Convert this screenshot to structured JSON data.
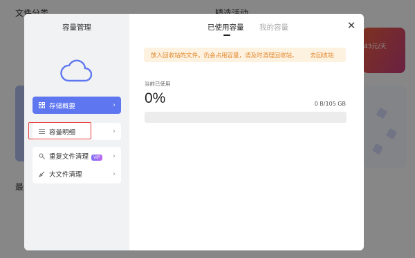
{
  "background": {
    "left_title": "文件分类",
    "mid_title": "精选活动",
    "left_label": "最",
    "banner_text": "43元/天"
  },
  "modal": {
    "sidebar": {
      "title": "容量管理",
      "items": [
        {
          "label": "存储概要",
          "icon": "grid-icon",
          "active": true
        },
        {
          "label": "容量明细",
          "icon": "list-icon",
          "active": false
        },
        {
          "label": "重复文件清理",
          "icon": "dedupe-icon",
          "badge": "VIP",
          "active": false
        },
        {
          "label": "大文件清理",
          "icon": "broom-icon",
          "active": false
        }
      ]
    },
    "tabs": [
      {
        "label": "已使用容量",
        "active": true
      },
      {
        "label": "我的容量",
        "active": false
      }
    ],
    "notice": {
      "text": "放入回收站的文件，仍会占用容量，请及时清理回收站。",
      "link": "去回收站"
    },
    "usage": {
      "label": "当前已使用",
      "percent_text": "0%",
      "percent_value": 0,
      "size_text": "0 B/105 GB"
    },
    "colors": {
      "accent": "#5e77f0",
      "notice_text": "#e3892c",
      "notice_bg": "#fdf1e0",
      "highlight": "#e53935"
    }
  }
}
